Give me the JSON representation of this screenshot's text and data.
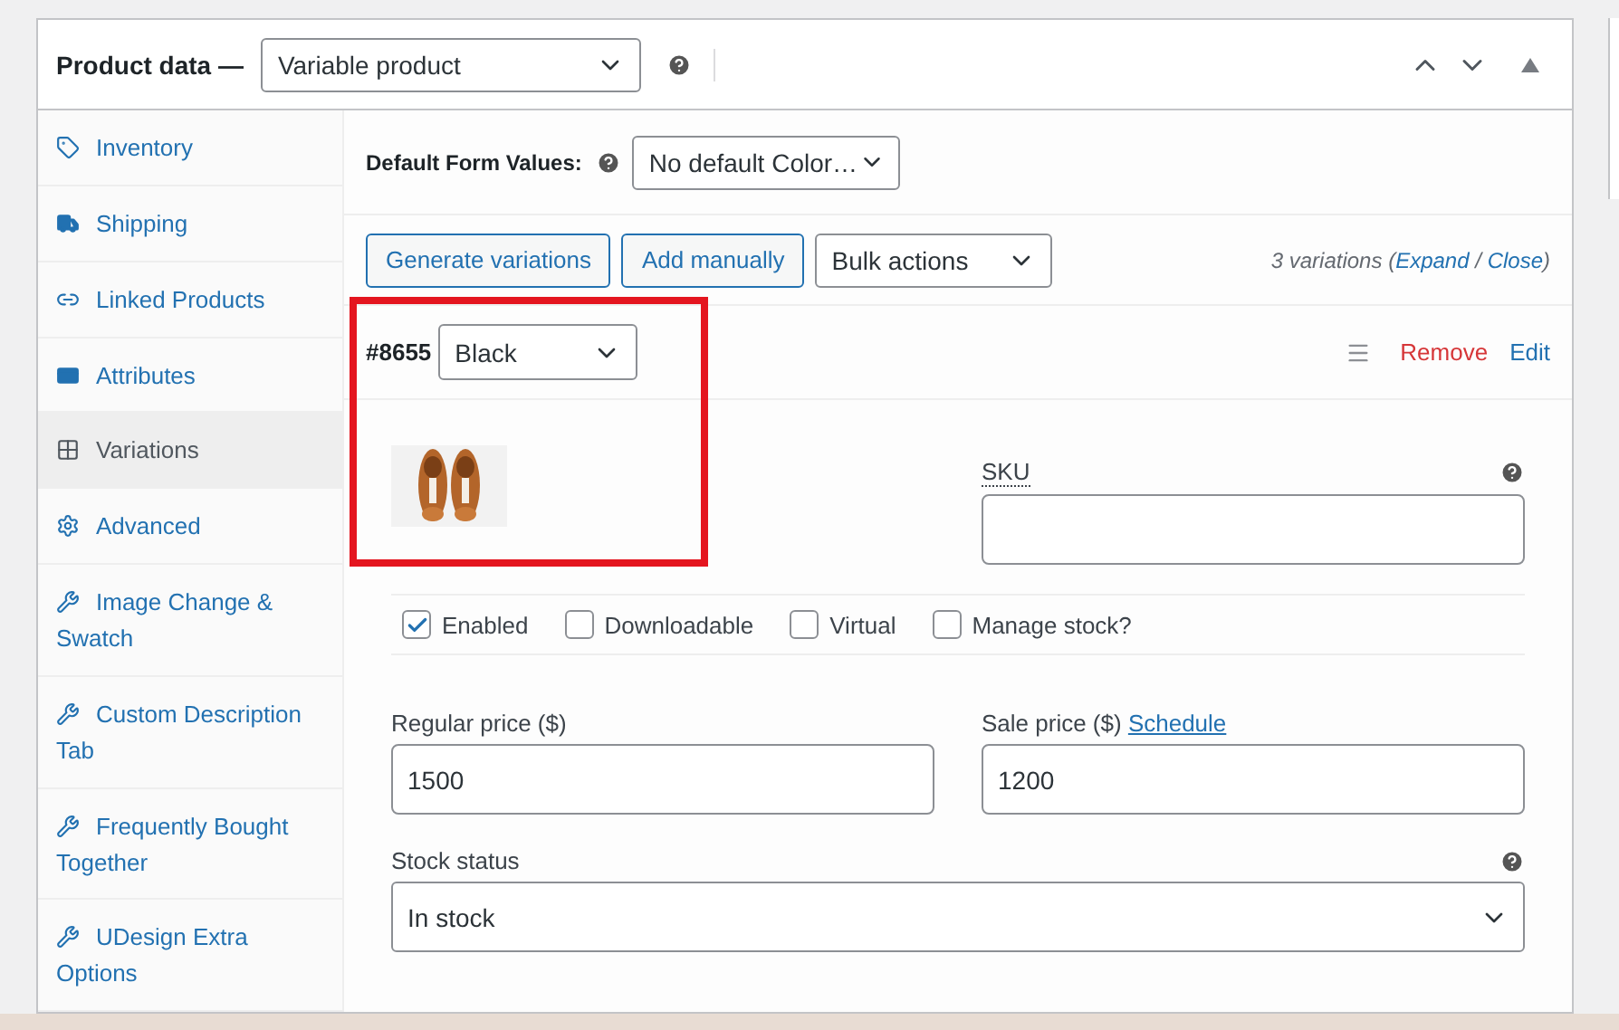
{
  "header": {
    "title": "Product data —",
    "product_type": "Variable product"
  },
  "sidebar": {
    "items": [
      {
        "label": "Inventory",
        "selected": false
      },
      {
        "label": "Shipping",
        "selected": false
      },
      {
        "label": "Linked Products",
        "selected": false
      },
      {
        "label": "Attributes",
        "selected": false
      },
      {
        "label": "Variations",
        "selected": true
      },
      {
        "label": "Advanced",
        "selected": false
      },
      {
        "label": "Image Change & Swatch",
        "selected": false
      },
      {
        "label": "Custom Description Tab",
        "selected": false
      },
      {
        "label": "Frequently Bought Together",
        "selected": false
      },
      {
        "label": "UDesign Extra Options",
        "selected": false
      }
    ]
  },
  "default_form": {
    "label": "Default Form Values:",
    "value": "No default Color…"
  },
  "toolbar": {
    "buttons": [
      "Generate variations",
      "Add manually"
    ],
    "bulk": "Bulk actions",
    "count": "3 variations",
    "open_paren": "(",
    "expand": "Expand",
    "separator": "/",
    "close": "Close",
    "close_paren": ")"
  },
  "variation": {
    "id": "#8655",
    "attribute_value": "Black",
    "remove": "Remove",
    "edit": "Edit",
    "sku": {
      "label": "SKU"
    },
    "options": [
      {
        "label": "Enabled",
        "checked": true
      },
      {
        "label": "Downloadable",
        "checked": false
      },
      {
        "label": "Virtual",
        "checked": false
      },
      {
        "label": "Manage stock?",
        "checked": false
      }
    ],
    "regular_price": {
      "label": "Regular price ($)",
      "value": "1500"
    },
    "sale_price": {
      "label": "Sale price ($)",
      "link": "Schedule",
      "value": "1200"
    },
    "stock_status": {
      "label": "Stock status",
      "value": "In stock"
    }
  }
}
